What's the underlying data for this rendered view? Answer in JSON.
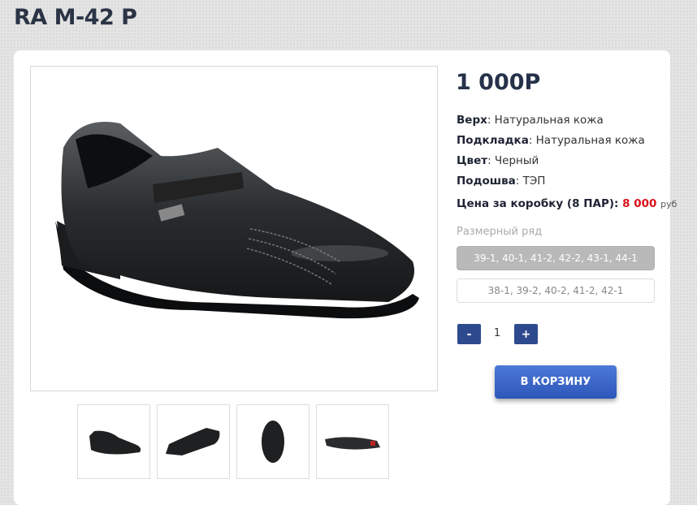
{
  "product": {
    "title": "RA M-42 P",
    "price": "1 000Р",
    "specs": [
      {
        "label": "Верх",
        "value": ": Натуральная кожа"
      },
      {
        "label": "Подкладка",
        "value": ": Натуральная кожа"
      },
      {
        "label": "Цвет",
        "value": ": Черный"
      },
      {
        "label": "Подошва",
        "value": ": ТЭП"
      }
    ],
    "box_price": {
      "label": "Цена за коробку (8 ПАР): ",
      "value": "8 000",
      "currency": "руб"
    },
    "size_label": "Размерный ряд",
    "size_options": [
      "39-1, 40-1, 41-2, 42-2, 43-1, 44-1",
      "38-1, 39-2, 40-2, 41-2, 42-1"
    ],
    "quantity": {
      "minus": "-",
      "value": "1",
      "plus": "+"
    },
    "cart_button": "В КОРЗИНУ"
  },
  "colors": {
    "accent": "#2e4a8e",
    "price_red": "#d8141b",
    "title": "#2b3445"
  },
  "images": {
    "main": "black-leather-shoe-side-view",
    "thumbs": [
      "shoe-angle-1",
      "shoe-angle-2",
      "shoe-front",
      "shoe-sole"
    ]
  }
}
